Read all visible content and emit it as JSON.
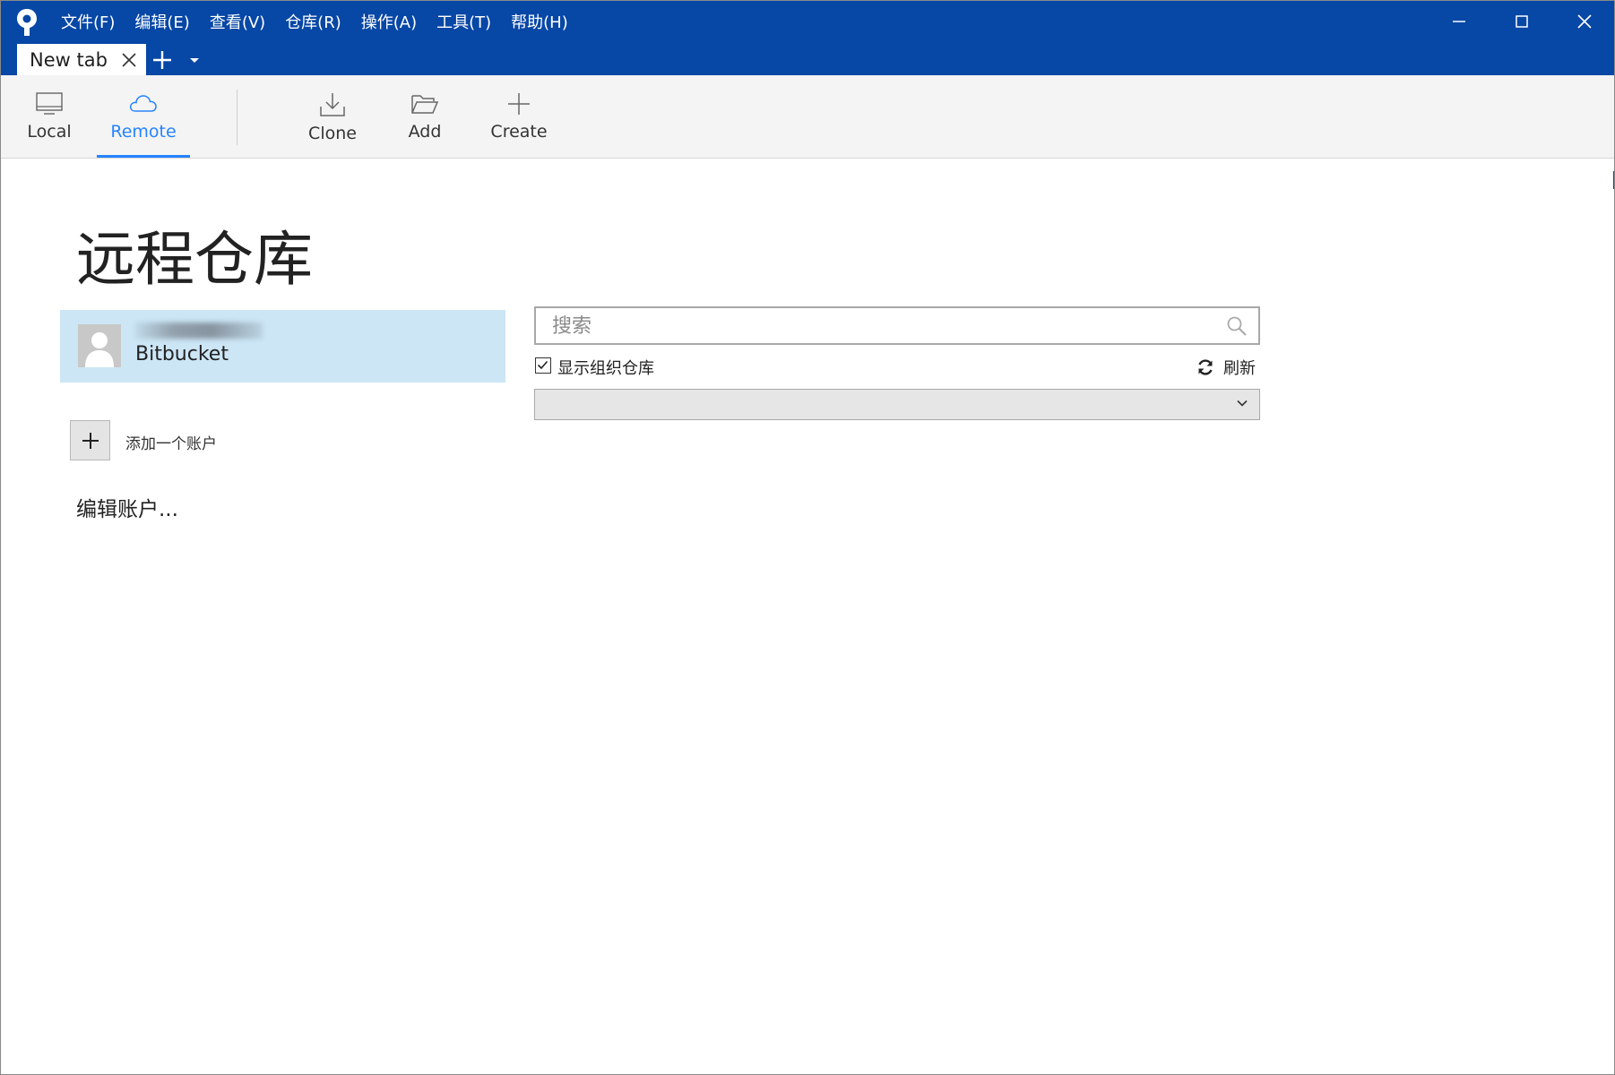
{
  "menu": {
    "items": [
      "文件(F)",
      "编辑(E)",
      "查看(V)",
      "仓库(R)",
      "操作(A)",
      "工具(T)",
      "帮助(H)"
    ]
  },
  "tabs": [
    {
      "label": "New tab"
    }
  ],
  "toolbar": {
    "local_label": "Local",
    "remote_label": "Remote",
    "clone_label": "Clone",
    "add_label": "Add",
    "create_label": "Create",
    "active": "Remote"
  },
  "main": {
    "title": "远程仓库",
    "account": {
      "type": "Bitbucket"
    },
    "add_account_label": "添加一个账户",
    "edit_accounts_label": "编辑账户...",
    "search": {
      "placeholder": "搜索",
      "value": ""
    },
    "show_org_repos": {
      "label": "显示组织仓库",
      "checked": true
    },
    "refresh_label": "刷新",
    "dropdown": {
      "selected": ""
    }
  },
  "colors": {
    "title_bar": "#0747a6",
    "accent": "#2684ff",
    "selected_account_bg": "#cce6f6"
  },
  "icons": [
    "sourcetree-logo-icon",
    "minimize-icon",
    "maximize-icon",
    "close-icon",
    "tab-close-icon",
    "new-tab-icon",
    "tab-dropdown-icon",
    "monitor-icon",
    "cloud-icon",
    "clone-download-icon",
    "folder-open-icon",
    "plus-icon",
    "avatar-placeholder-icon",
    "search-icon",
    "checkbox-checked-icon",
    "refresh-icon",
    "chevron-down-icon"
  ]
}
